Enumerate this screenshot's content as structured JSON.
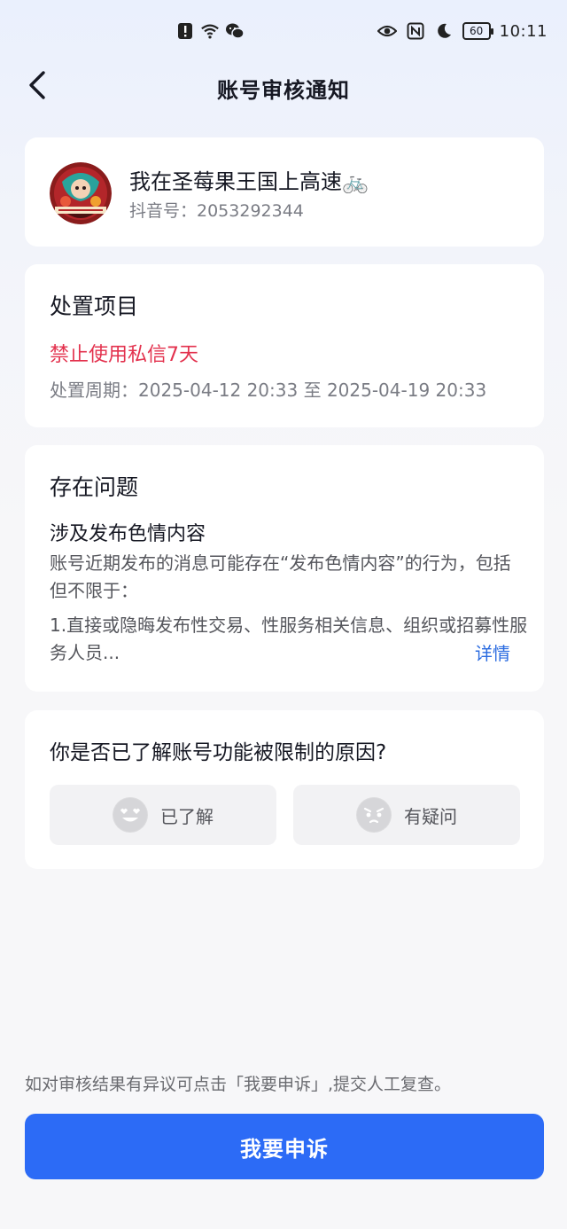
{
  "status_bar": {
    "time": "10:11",
    "battery": "60",
    "left_icons": [
      "alert-icon",
      "wifi-icon",
      "wechat-icon"
    ],
    "right_icons": [
      "eye-icon",
      "nfc-icon",
      "moon-icon"
    ]
  },
  "nav": {
    "back_icon": "chevron-left-icon",
    "title": "账号审核通知"
  },
  "profile": {
    "nickname": "我在圣莓果王国上高速🚲",
    "douyin_id": "抖音号：2053292344"
  },
  "penalty": {
    "title": "处置项目",
    "name": "禁止使用私信7天",
    "period": "处置周期：2025-04-12 20:33 至 2025-04-19 20:33"
  },
  "issue": {
    "title": "存在问题",
    "subtitle": "涉及发布色情内容",
    "description": "账号近期发布的消息可能存在“发布色情内容”的行为，包括但不限于：",
    "item": "1.直接或隐晦发布性交易、性服务相关信息、组织或招募性服务人员...",
    "detail_link": "详情"
  },
  "question": {
    "title": "你是否已了解账号功能被限制的原因?",
    "options": [
      {
        "label": "已了解",
        "icon": "heart-eyes-emoji-icon"
      },
      {
        "label": "有疑问",
        "icon": "confused-emoji-icon"
      }
    ]
  },
  "appeal": {
    "hint": "如对审核结果有异议可点击「我要申诉」,提交人工复查。",
    "button_label": "我要申诉"
  },
  "colors": {
    "accent_blue": "#2c6bf6",
    "warning_red": "#e3324e",
    "link_blue": "#2a6be0"
  }
}
